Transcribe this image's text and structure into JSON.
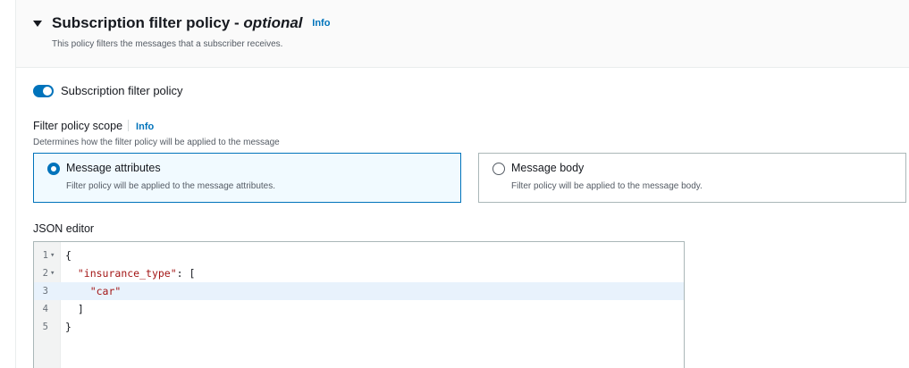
{
  "section": {
    "title": "Subscription filter policy",
    "title_sep": " - ",
    "title_optional": "optional",
    "info": "Info",
    "description": "This policy filters the messages that a subscriber receives."
  },
  "toggle": {
    "label": "Subscription filter policy",
    "enabled": true
  },
  "scope": {
    "label": "Filter policy scope",
    "info": "Info",
    "description": "Determines how the filter policy will be applied to the message",
    "options": [
      {
        "title": "Message attributes",
        "description": "Filter policy will be applied to the message attributes.",
        "selected": true
      },
      {
        "title": "Message body",
        "description": "Filter policy will be applied to the message body.",
        "selected": false
      }
    ]
  },
  "editor": {
    "label": "JSON editor",
    "lines": [
      {
        "num": "1",
        "indent": "",
        "text": "{",
        "string": ""
      },
      {
        "num": "2",
        "indent": "  ",
        "text": "",
        "string": "\"insurance_type\"",
        "after": ": ["
      },
      {
        "num": "3",
        "indent": "    ",
        "text": "",
        "string": "\"car\"",
        "after": ""
      },
      {
        "num": "4",
        "indent": "  ",
        "text": "]",
        "string": ""
      },
      {
        "num": "5",
        "indent": "",
        "text": "}",
        "string": ""
      }
    ],
    "active_line": 3
  },
  "colors": {
    "accent": "#0073bb",
    "json_string": "#a31515"
  }
}
